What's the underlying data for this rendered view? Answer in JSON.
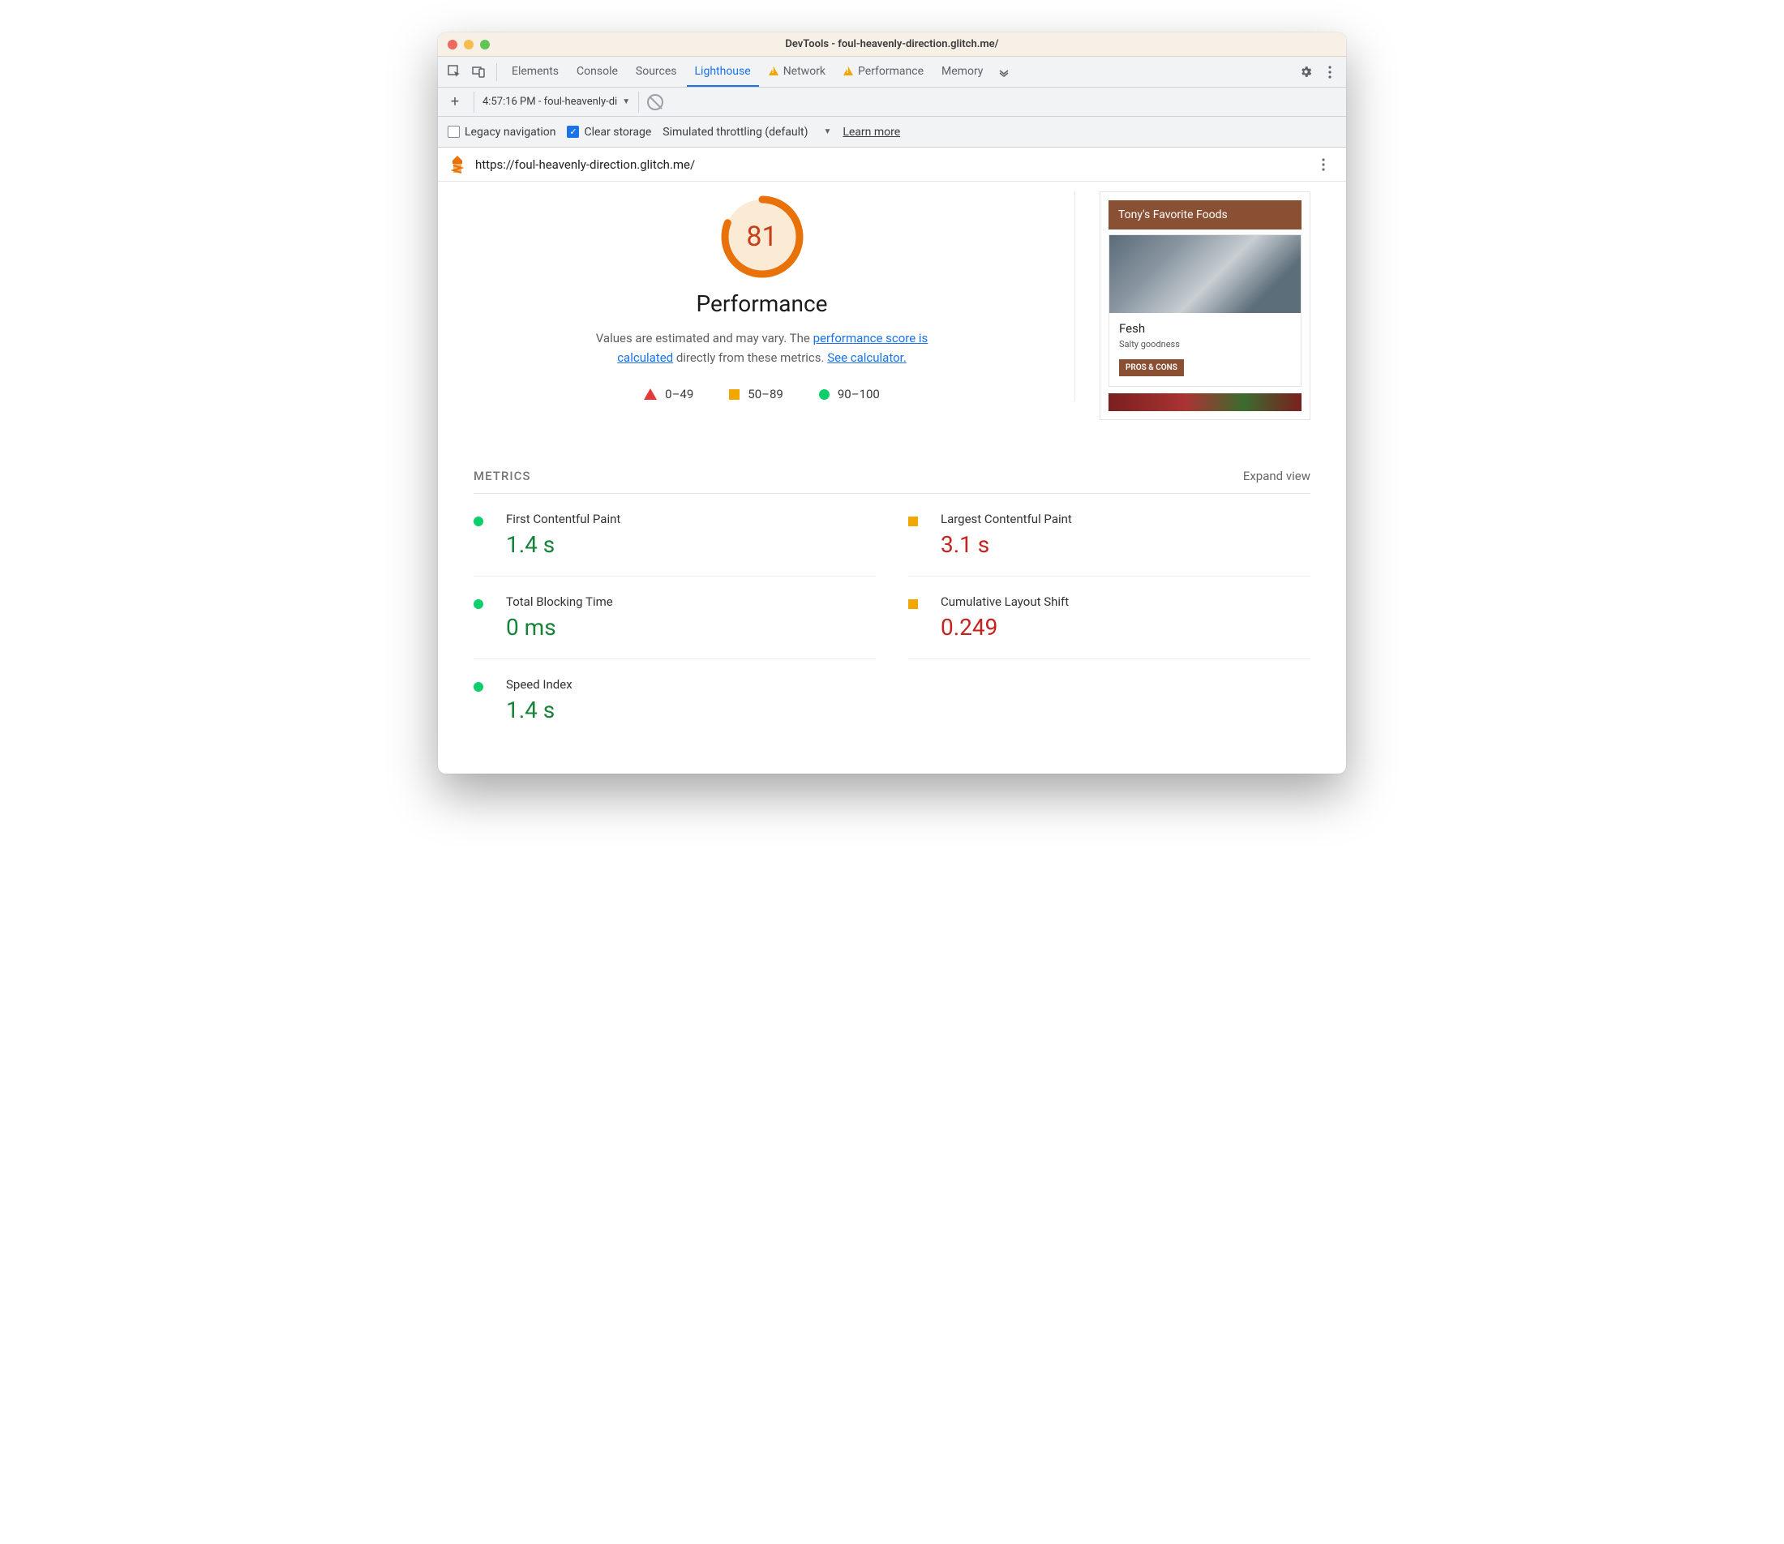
{
  "window": {
    "title": "DevTools - foul-heavenly-direction.glitch.me/"
  },
  "tabs": {
    "elements": "Elements",
    "console": "Console",
    "sources": "Sources",
    "lighthouse": "Lighthouse",
    "network": "Network",
    "performance": "Performance",
    "memory": "Memory"
  },
  "sub": {
    "audit_label": "4:57:16 PM - foul-heavenly-di"
  },
  "options": {
    "legacy_label": "Legacy navigation",
    "clear_label": "Clear storage",
    "throttling_label": "Simulated throttling (default)",
    "learn": "Learn more"
  },
  "url": "https://foul-heavenly-direction.glitch.me/",
  "gauge": {
    "score": "81",
    "title": "Performance",
    "desc_pre": "Values are estimated and may vary. The ",
    "link1": "performance score is calculated",
    "desc_mid": " directly from these metrics. ",
    "link2": "See calculator."
  },
  "legend": {
    "r": "0–49",
    "a": "50–89",
    "g": "90–100"
  },
  "preview": {
    "header": "Tony's Favorite Foods",
    "card_title": "Fesh",
    "card_sub": "Salty goodness",
    "card_btn": "PROS & CONS"
  },
  "metrics_head": {
    "title": "METRICS",
    "expand": "Expand view"
  },
  "metrics": {
    "fcp": {
      "name": "First Contentful Paint",
      "val": "1.4 s"
    },
    "lcp": {
      "name": "Largest Contentful Paint",
      "val": "3.1 s"
    },
    "tbt": {
      "name": "Total Blocking Time",
      "val": "0 ms"
    },
    "cls": {
      "name": "Cumulative Layout Shift",
      "val": "0.249"
    },
    "si": {
      "name": "Speed Index",
      "val": "1.4 s"
    }
  }
}
